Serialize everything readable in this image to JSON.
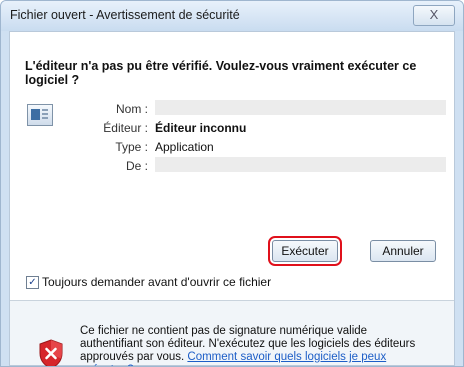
{
  "window": {
    "title": "Fichier ouvert - Avertissement de sécurité",
    "close_label": "X"
  },
  "dialog": {
    "question": "L'éditeur n'a pas pu être vérifié. Voulez-vous vraiment exécuter ce logiciel ?",
    "fields": [
      {
        "label": "Nom :",
        "value": ""
      },
      {
        "label": "Éditeur :",
        "value": "Éditeur inconnu"
      },
      {
        "label": "Type :",
        "value": "Application"
      },
      {
        "label": "De :",
        "value": ""
      }
    ],
    "run_label": "Exécuter",
    "cancel_label": "Annuler",
    "always_ask_label": "Toujours demander avant d'ouvrir ce fichier",
    "always_ask_checked": true,
    "warning_text": "Ce fichier ne contient pas de signature numérique valide authentifiant son éditeur. N'exécutez que les logiciels des éditeurs approuvés par vous. ",
    "help_link": "Comment savoir quels logiciels je peux exécuter ?"
  },
  "icons": {
    "app": "application-icon",
    "security": "shield-warning-icon"
  },
  "colors": {
    "accent_highlight": "#e0101b",
    "link": "#1d5ec7"
  }
}
